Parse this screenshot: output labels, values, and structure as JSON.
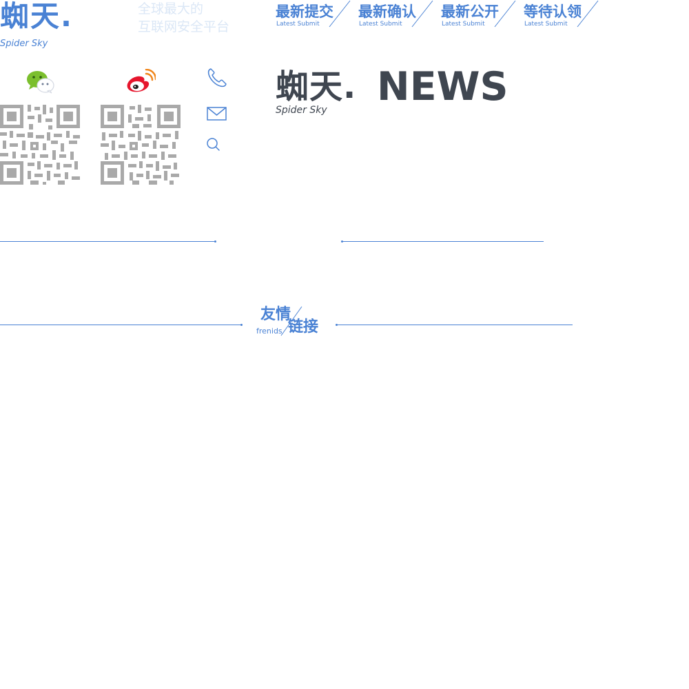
{
  "brand": {
    "name": "蜘天.",
    "tagline": "Spider  Sky",
    "slogan": [
      "全球最大的",
      "互联网安全平台"
    ]
  },
  "nav": [
    {
      "label": "最新提交",
      "sub": "Latest Submit"
    },
    {
      "label": "最新确认",
      "sub": "Latest Submit"
    },
    {
      "label": "最新公开",
      "sub": "Latest Submit"
    },
    {
      "label": "等待认领",
      "sub": "Latest Submit"
    }
  ],
  "social": {
    "wechat_icon": "wechat-icon",
    "weibo_icon": "weibo-icon"
  },
  "contact_icons": [
    "phone-icon",
    "mail-icon",
    "search-icon"
  ],
  "news_header": {
    "brand": "蜘天.",
    "label": "NEWS",
    "tagline": "Spider  Sky"
  },
  "friends": {
    "title_1": "友情",
    "title_2": "链接",
    "sub": "frenids"
  },
  "colors": {
    "accent": "#4a82d4",
    "dark": "#3f4650",
    "slogan": "#dbe7f6",
    "qr": "#a9a9a9",
    "weibo_red": "#e6162d",
    "wechat_green": "#7bbf2d"
  }
}
